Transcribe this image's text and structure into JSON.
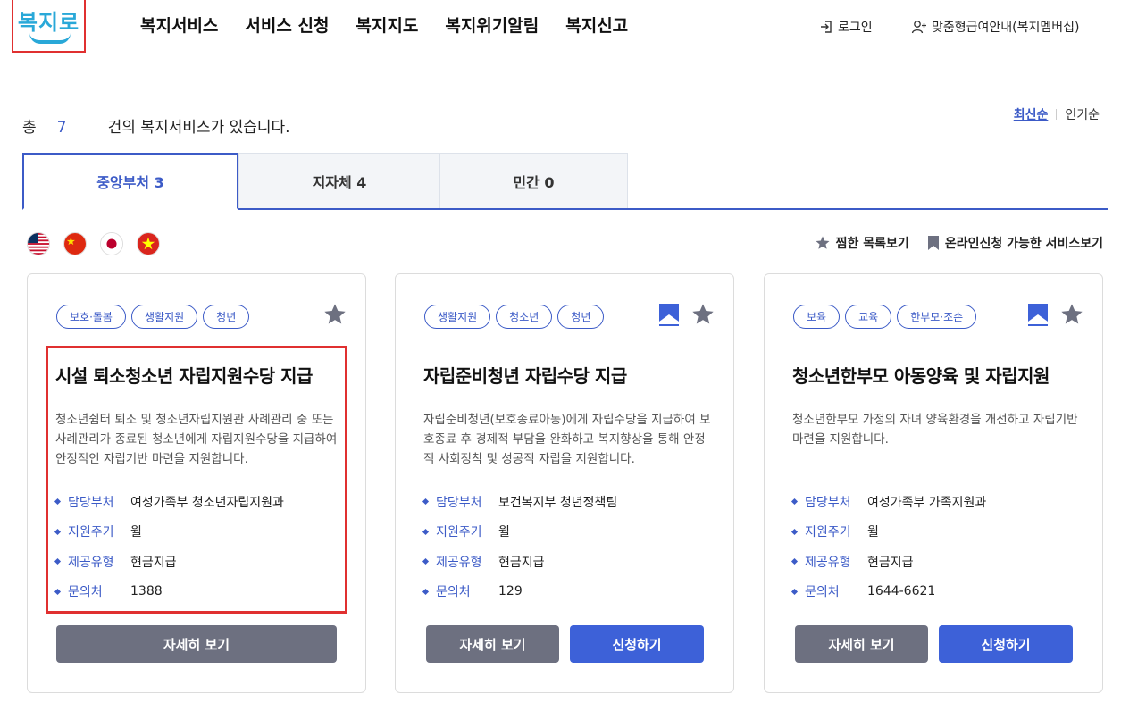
{
  "header": {
    "logo_text": "복지로",
    "nav": [
      "복지서비스",
      "서비스 신청",
      "복지지도",
      "복지위기알림",
      "복지신고"
    ],
    "login_label": "로그인",
    "member_label": "맞춤형급여안내(복지멤버십)"
  },
  "summary": {
    "prefix": "총",
    "count": "7",
    "suffix": "건의 복지서비스가 있습니다."
  },
  "sort": {
    "latest": "최신순",
    "popular": "인기순"
  },
  "tabs": [
    {
      "label": "중앙부처 3",
      "active": true
    },
    {
      "label": "지자체 4",
      "active": false
    },
    {
      "label": "민간 0",
      "active": false
    }
  ],
  "languages": [
    "us-flag-icon",
    "cn-flag-icon",
    "jp-flag-icon",
    "vn-flag-icon"
  ],
  "filters": {
    "favorites": "찜한 목록보기",
    "online": "온라인신청 가능한 서비스보기"
  },
  "cards": [
    {
      "tags": [
        "보호·돌봄",
        "생활지원",
        "청년"
      ],
      "title": "시설 퇴소청소년 자립지원수당 지급",
      "description": "청소년쉼터 퇴소 및 청소년자립지원관 사례관리 중 또는 사례관리가 종료된 청소년에게 자립지원수당을 지급하여 안정적인 자립기반 마련을 지원합니다.",
      "info": [
        {
          "label": "담당부처",
          "value": "여성가족부 청소년자립지원과"
        },
        {
          "label": "지원주기",
          "value": "월"
        },
        {
          "label": "제공유형",
          "value": "현금지급"
        },
        {
          "label": "문의처",
          "value": "1388"
        }
      ],
      "detail_label": "자세히 보기",
      "online": false
    },
    {
      "tags": [
        "생활지원",
        "청소년",
        "청년"
      ],
      "title": "자립준비청년 자립수당 지급",
      "description": "자립준비청년(보호종료아동)에게 자립수당을 지급하여 보호종료 후 경제적 부담을 완화하고 복지향상을 통해 안정적 사회정착 및 성공적 자립을 지원합니다.",
      "info": [
        {
          "label": "담당부처",
          "value": "보건복지부 청년정책팀"
        },
        {
          "label": "지원주기",
          "value": "월"
        },
        {
          "label": "제공유형",
          "value": "현금지급"
        },
        {
          "label": "문의처",
          "value": "129"
        }
      ],
      "detail_label": "자세히 보기",
      "apply_label": "신청하기",
      "online": true
    },
    {
      "tags": [
        "보육",
        "교육",
        "한부모·조손"
      ],
      "title": "청소년한부모 아동양육 및 자립지원",
      "description": "청소년한부모 가정의 자녀 양육환경을 개선하고 자립기반 마련을 지원합니다.",
      "info": [
        {
          "label": "담당부처",
          "value": "여성가족부 가족지원과"
        },
        {
          "label": "지원주기",
          "value": "월"
        },
        {
          "label": "제공유형",
          "value": "현금지급"
        },
        {
          "label": "문의처",
          "value": "1644-6621"
        }
      ],
      "detail_label": "자세히 보기",
      "apply_label": "신청하기",
      "online": true
    }
  ],
  "colors": {
    "accent": "#3c5bc7",
    "apply_button": "#3d61d8",
    "detail_button": "#6d7080",
    "highlight": "#e03030"
  }
}
